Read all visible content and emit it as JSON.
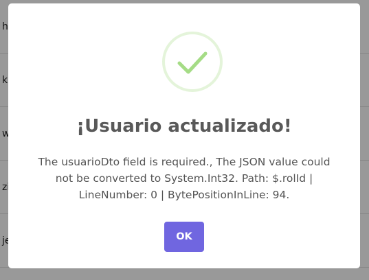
{
  "background": {
    "rows": [
      {
        "text": "h"
      },
      {
        "text": "k"
      },
      {
        "text": "w"
      },
      {
        "text": "zi"
      },
      {
        "text": "je"
      }
    ]
  },
  "modal": {
    "icon": "success-check-icon",
    "title": "¡Usuario actualizado!",
    "message": "The usuarioDto field is required., The JSON value could not be converted to System.Int32. Path: $.rolId | LineNumber: 0 | BytePositionInLine: 94.",
    "ok_label": "OK"
  },
  "colors": {
    "accent_button": "#7066e0",
    "success_check": "#a5dc86",
    "title_text": "#595959",
    "message_text": "#545454"
  }
}
